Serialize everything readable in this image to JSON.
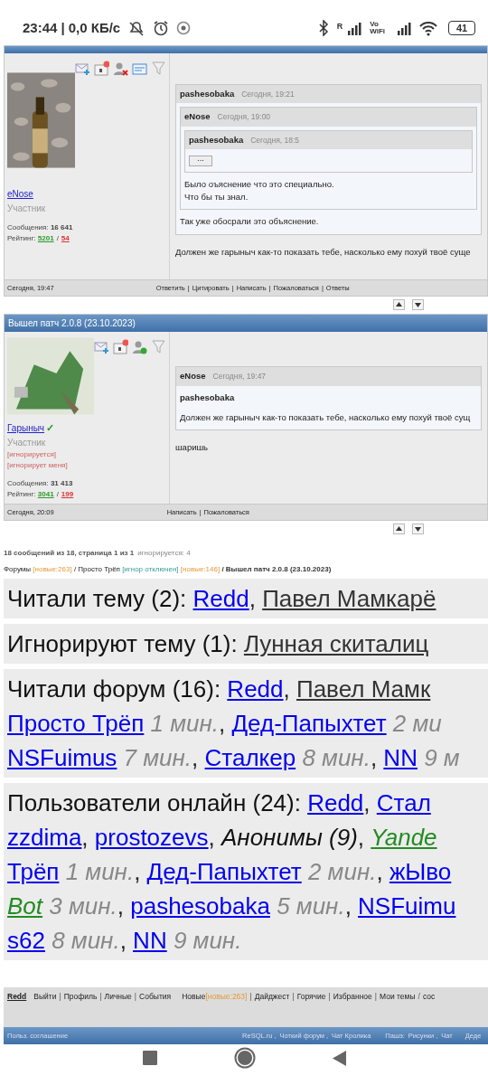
{
  "status_bar": {
    "time": "23:44",
    "speed": "| 0,0 КБ/с",
    "roaming": "R",
    "vowifi": [
      "Vo",
      "WiFi"
    ],
    "battery": "41"
  },
  "posts": [
    {
      "toolbar_icons": [
        {
          "kind": "mail-add"
        },
        {
          "kind": "card"
        },
        {
          "kind": "user-remove"
        },
        {
          "kind": "id-card"
        },
        {
          "kind": "funnel"
        }
      ],
      "author": "eNose",
      "verified": false,
      "role": "Участник",
      "messages_label": "Сообщения:",
      "messages": "16 641",
      "rating_label": "Рейтинг:",
      "rating_plus": "5201",
      "rating_sep": "/",
      "rating_minus": "54",
      "avatar": {
        "kind": "photo"
      },
      "date": "Сегодня, 19:47",
      "action_sep": "|",
      "actions": [
        "Ответить",
        "Цитировать",
        "Написать",
        "Пожаловаться",
        "Ответы"
      ],
      "body": {
        "quote": {
          "author": "pashesobaka",
          "time": "Сегодня, 19:21",
          "quote": {
            "author": "eNose",
            "time": "Сегодня, 19:00",
            "quote": {
              "author": "pashesobaka",
              "time": "Сегодня, 18:5",
              "collapsed": "···"
            },
            "lines": [
              "Было оъяснение что это специально.",
              "Что бы ты знал."
            ]
          },
          "lines": [
            "Так уже обосрали это объяснение."
          ]
        },
        "lines": [
          "Должен же гарыныч как-то показать тебе, насколько ему похуй твоё суще"
        ]
      }
    },
    {
      "title": "Вышел патч 2.0.8 (23.10.2023)",
      "toolbar_icons": [
        {
          "kind": "mail-add"
        },
        {
          "kind": "card"
        },
        {
          "kind": "user-add"
        },
        {
          "kind": "funnel"
        }
      ],
      "author": "Гарыныч",
      "verified": true,
      "verified_mark": "✓",
      "role": "Участник",
      "flags": [
        "[игнорируется]",
        "[игнорирует меня]"
      ],
      "messages_label": "Сообщения:",
      "messages": "31 413",
      "rating_label": "Рейтинг:",
      "rating_plus": "3041",
      "rating_sep": "/",
      "rating_minus": "199",
      "avatar": {
        "kind": "comic"
      },
      "date": "Сегодня, 20:09",
      "action_sep": "|",
      "actions": [
        "Написать",
        "Пожаловаться"
      ],
      "body": {
        "quote": {
          "author": "eNose",
          "time": "Сегодня, 19:47",
          "inner_author": "pashesobaka",
          "lines": [
            "Должен же гарыныч как-то показать тебе, насколько ему похуй твоё сущ"
          ]
        },
        "lines": [
          "шаришь"
        ]
      }
    }
  ],
  "summary": {
    "count": "18 сообщений из 18, страница 1 из 1",
    "ignored": "игнорируется: 4"
  },
  "breadcrumbs": [
    {
      "kind": "link",
      "text": "Форумы"
    },
    {
      "kind": "new",
      "text": "[новые:263]"
    },
    {
      "kind": "sep",
      "text": "/"
    },
    {
      "kind": "link",
      "text": "Просто Трёп"
    },
    {
      "kind": "ignore",
      "text": "[игнор отключен]"
    },
    {
      "kind": "new",
      "text": "[новые:146]"
    },
    {
      "kind": "current",
      "text": "/ Вышел патч 2.0.8 (23.10.2023)"
    }
  ],
  "presence": [
    {
      "lines": [
        [
          {
            "kind": "label",
            "text": "Читали тему (2): "
          },
          {
            "kind": "link",
            "text": "Redd"
          },
          {
            "kind": "text",
            "text": ", "
          },
          {
            "kind": "dark-link",
            "text": "Павел Мамкарё"
          }
        ]
      ]
    },
    {
      "lines": [
        [
          {
            "kind": "label",
            "text": "Игнорируют тему (1): "
          },
          {
            "kind": "dark-link",
            "text": "Лунная скиталиц"
          }
        ]
      ]
    },
    {
      "lines": [
        [
          {
            "kind": "label",
            "text": "Читали форум (16): "
          },
          {
            "kind": "link",
            "text": "Redd"
          },
          {
            "kind": "text",
            "text": ", "
          },
          {
            "kind": "dark-link",
            "text": "Павел Мамк"
          }
        ],
        [
          {
            "kind": "link",
            "text": "Просто Трёп"
          },
          {
            "kind": "time",
            "text": " 1 мин."
          },
          {
            "kind": "text",
            "text": ", "
          },
          {
            "kind": "link",
            "text": "Дед-Папыхтет"
          },
          {
            "kind": "time",
            "text": " 2 ми"
          }
        ],
        [
          {
            "kind": "link",
            "text": "NSFuimus"
          },
          {
            "kind": "time",
            "text": " 7 мин."
          },
          {
            "kind": "text",
            "text": ", "
          },
          {
            "kind": "link",
            "text": "Сталкер"
          },
          {
            "kind": "time",
            "text": " 8 мин."
          },
          {
            "kind": "text",
            "text": ", "
          },
          {
            "kind": "link",
            "text": "NN"
          },
          {
            "kind": "time",
            "text": " 9 м"
          }
        ]
      ]
    },
    {
      "lines": [
        [
          {
            "kind": "label",
            "text": "Пользователи онлайн (24): "
          },
          {
            "kind": "link",
            "text": "Redd"
          },
          {
            "kind": "text",
            "text": ", "
          },
          {
            "kind": "link",
            "text": "Стал"
          }
        ],
        [
          {
            "kind": "link",
            "text": "zzdima"
          },
          {
            "kind": "text",
            "text": ", "
          },
          {
            "kind": "link",
            "text": "prostozevs"
          },
          {
            "kind": "text",
            "text": ", "
          },
          {
            "kind": "anon",
            "text": "Анонимы (9)"
          },
          {
            "kind": "text",
            "text": ", "
          },
          {
            "kind": "bot",
            "text": "Yande"
          }
        ],
        [
          {
            "kind": "link",
            "text": "Трёп"
          },
          {
            "kind": "time",
            "text": " 1 мин."
          },
          {
            "kind": "text",
            "text": ", "
          },
          {
            "kind": "link",
            "text": "Дед-Папыхтет"
          },
          {
            "kind": "time",
            "text": " 2 мин."
          },
          {
            "kind": "text",
            "text": ", "
          },
          {
            "kind": "link",
            "text": "жЫво"
          }
        ],
        [
          {
            "kind": "bot",
            "text": "Bot"
          },
          {
            "kind": "time",
            "text": " 3 мин."
          },
          {
            "kind": "text",
            "text": ", "
          },
          {
            "kind": "link",
            "text": "pashesobaka"
          },
          {
            "kind": "time",
            "text": " 5 мин."
          },
          {
            "kind": "text",
            "text": ", "
          },
          {
            "kind": "link",
            "text": "NSFuimu"
          }
        ],
        [
          {
            "kind": "link",
            "text": "s62"
          },
          {
            "kind": "time",
            "text": " 8 мин."
          },
          {
            "kind": "text",
            "text": ", "
          },
          {
            "kind": "link",
            "text": "NN"
          },
          {
            "kind": "time",
            "text": " 9 мин."
          }
        ]
      ]
    }
  ],
  "user_nav": [
    {
      "kind": "user",
      "text": "Redd"
    },
    {
      "kind": "link",
      "text": "Выйти"
    },
    {
      "kind": "sep",
      "text": "|"
    },
    {
      "kind": "link",
      "text": "Профиль"
    },
    {
      "kind": "sep",
      "text": "|"
    },
    {
      "kind": "link",
      "text": "Личные"
    },
    {
      "kind": "sep",
      "text": "|"
    },
    {
      "kind": "link",
      "text": "События"
    },
    {
      "kind": "gap"
    },
    {
      "kind": "link",
      "text": "Новые"
    },
    {
      "kind": "new",
      "text": "[новые:263]"
    },
    {
      "kind": "sep",
      "text": "|"
    },
    {
      "kind": "link",
      "text": "Дайджест"
    },
    {
      "kind": "sep",
      "text": "|"
    },
    {
      "kind": "link",
      "text": "Горячие"
    },
    {
      "kind": "sep",
      "text": "|"
    },
    {
      "kind": "link",
      "text": "Избранное"
    },
    {
      "kind": "sep",
      "text": "|"
    },
    {
      "kind": "link",
      "text": "Мои темы"
    },
    {
      "kind": "sep",
      "text": "/"
    },
    {
      "kind": "link",
      "text": "сос"
    }
  ],
  "footer": [
    {
      "kind": "link",
      "text": "Польз. соглашение"
    },
    {
      "kind": "gap"
    },
    {
      "kind": "link",
      "text": "ReSQL.ru"
    },
    {
      "kind": "text",
      "text": ","
    },
    {
      "kind": "link",
      "text": "Чоткий форум"
    },
    {
      "kind": "text",
      "text": ","
    },
    {
      "kind": "link",
      "text": "Чат Кролика"
    },
    {
      "kind": "space"
    },
    {
      "kind": "text",
      "text": "Пашэ:"
    },
    {
      "kind": "link",
      "text": "Рисунки"
    },
    {
      "kind": "text",
      "text": ","
    },
    {
      "kind": "link",
      "text": "Чат"
    },
    {
      "kind": "space"
    },
    {
      "kind": "link",
      "text": "Деде"
    }
  ]
}
